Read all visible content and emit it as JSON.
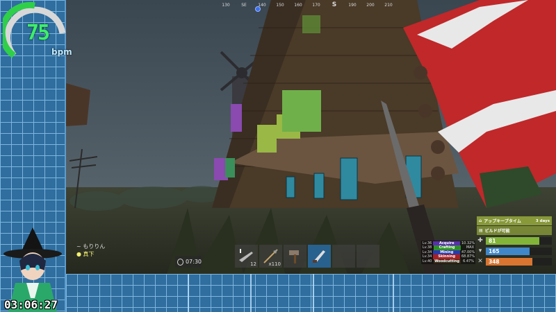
{
  "hud": {
    "heart_rate": {
      "value": "75",
      "unit": "bpm",
      "level": 0.75
    },
    "elapsed_time": "03:06:27",
    "compass": [
      {
        "label": "130",
        "bold": false
      },
      {
        "label": "SE",
        "bold": false
      },
      {
        "label": "140",
        "bold": false
      },
      {
        "label": "150",
        "bold": false
      },
      {
        "label": "160",
        "bold": false
      },
      {
        "label": "170",
        "bold": false
      },
      {
        "label": "S",
        "bold": true
      },
      {
        "label": "190",
        "bold": false
      },
      {
        "label": "200",
        "bold": false
      },
      {
        "label": "210",
        "bold": false
      }
    ],
    "chat": {
      "line1": "~ もりりん",
      "line2": "● 真下"
    },
    "clock": "07:30",
    "hotbar": [
      {
        "icon": "rifle-icon",
        "qty": "12",
        "active": false
      },
      {
        "icon": "arrow-icon",
        "qty": "x110",
        "active": false
      },
      {
        "icon": "hammer-icon",
        "qty": "",
        "active": false
      },
      {
        "icon": "knife-icon",
        "qty": "",
        "active": true
      },
      {
        "icon": "",
        "qty": "",
        "active": false
      },
      {
        "icon": "",
        "qty": "",
        "active": false
      }
    ],
    "skills": [
      {
        "level": "Lv.36",
        "name": "Acquire",
        "percent": "10.32%",
        "color": "#5a2fb0"
      },
      {
        "level": "Lv.38",
        "name": "Crafting",
        "percent": "MAX",
        "color": "#2e8f2a"
      },
      {
        "level": "Lv.34",
        "name": "Mining",
        "percent": "47.00%",
        "color": "#2c3aa8"
      },
      {
        "level": "Lv.34",
        "name": "Skinning",
        "percent": "68.87%",
        "color": "#a81f24"
      },
      {
        "level": "Lv.40",
        "name": "Woodcutting",
        "percent": "6.47%",
        "color": "#3a2a18"
      }
    ],
    "status": {
      "upkeep_label": "アップキープタイム",
      "upkeep_value": "3 days",
      "build_label": "ビルドが可能",
      "health": {
        "value": "81",
        "level": 0.81,
        "color": "#82b43a"
      },
      "water": {
        "value": "165",
        "level": 0.66,
        "color": "#3f87c8"
      },
      "food": {
        "value": "348",
        "level": 0.7,
        "color": "#d97530"
      }
    }
  }
}
